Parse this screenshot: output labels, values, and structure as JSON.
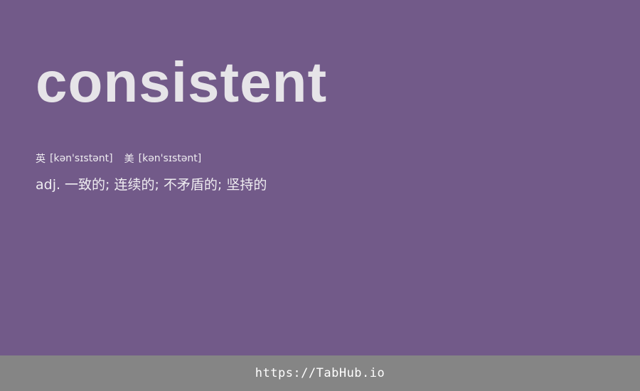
{
  "word": {
    "headword": "consistent"
  },
  "phonetics": [
    {
      "region": "英",
      "ipa": "[kən'sɪstənt]"
    },
    {
      "region": "美",
      "ipa": "[kən'sɪstənt]"
    }
  ],
  "definition": {
    "part_of_speech": "adj.",
    "meanings": "一致的; 连续的; 不矛盾的; 坚持的"
  },
  "footer": {
    "link_text": "https://TabHub.io"
  },
  "colors": {
    "background": "#725a89",
    "headword": "#e6e4e8",
    "text": "#efedf1",
    "footer_bar": "#858585",
    "footer_text": "#ffffff"
  }
}
